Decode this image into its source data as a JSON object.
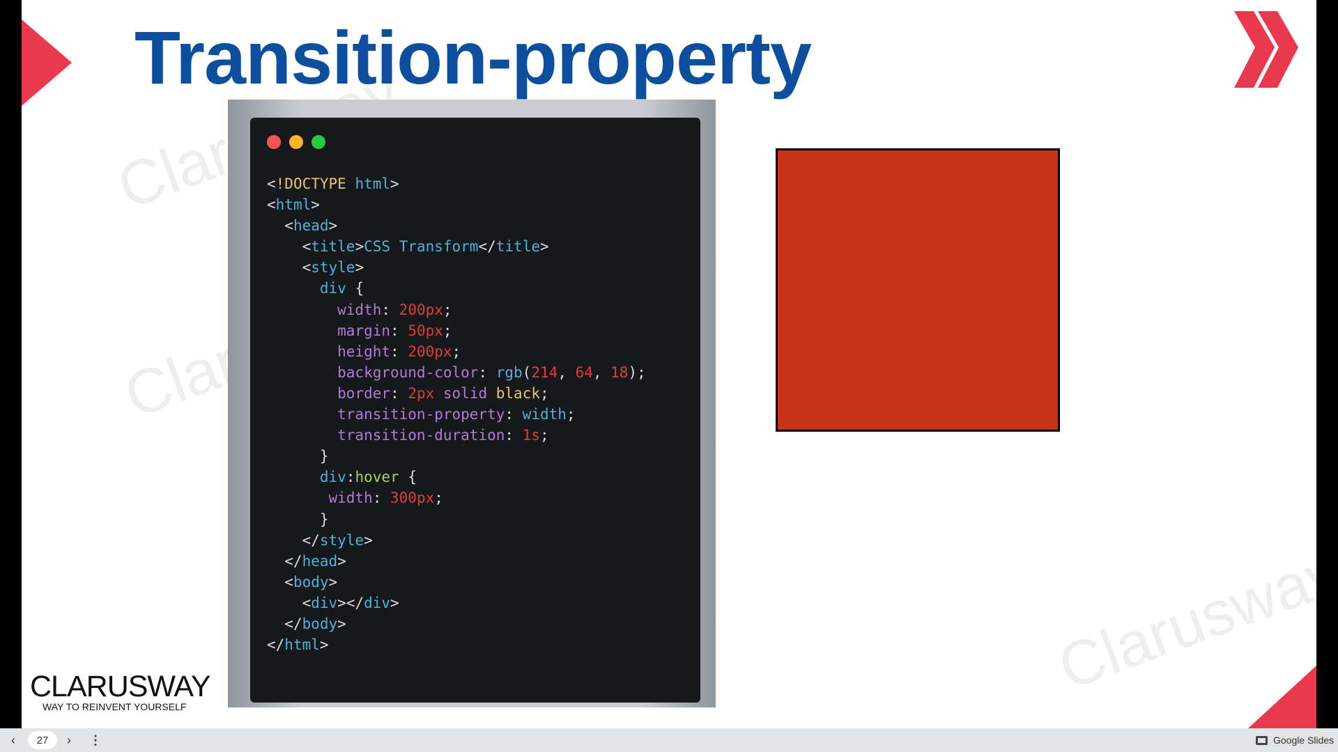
{
  "slide": {
    "title": "Transition-property",
    "code": [
      [
        [
          "p",
          "<"
        ],
        [
          "k",
          "!DOCTYPE"
        ],
        [
          "p",
          " "
        ],
        [
          "t",
          "html"
        ],
        [
          "p",
          ">"
        ]
      ],
      [
        [
          "p",
          "<"
        ],
        [
          "t",
          "html"
        ],
        [
          "p",
          ">"
        ]
      ],
      [
        [
          "p",
          "  <"
        ],
        [
          "t",
          "head"
        ],
        [
          "p",
          ">"
        ]
      ],
      [
        [
          "p",
          "    <"
        ],
        [
          "t",
          "title"
        ],
        [
          "p",
          ">"
        ],
        [
          "t",
          "CSS Transform"
        ],
        [
          "p",
          "</"
        ],
        [
          "t",
          "title"
        ],
        [
          "p",
          ">"
        ]
      ],
      [
        [
          "p",
          "    <"
        ],
        [
          "t",
          "style"
        ],
        [
          "p",
          ">"
        ]
      ],
      [
        [
          "t",
          "      div"
        ],
        [
          "p",
          " {"
        ]
      ],
      [
        [
          "a",
          "        width"
        ],
        [
          "p",
          ": "
        ],
        [
          "n",
          "200px"
        ],
        [
          "p",
          ";"
        ]
      ],
      [
        [
          "a",
          "        margin"
        ],
        [
          "p",
          ": "
        ],
        [
          "n",
          "50px"
        ],
        [
          "p",
          ";"
        ]
      ],
      [
        [
          "a",
          "        height"
        ],
        [
          "p",
          ": "
        ],
        [
          "n",
          "200px"
        ],
        [
          "p",
          ";"
        ]
      ],
      [
        [
          "a",
          "        background-color"
        ],
        [
          "p",
          ": "
        ],
        [
          "t",
          "rgb"
        ],
        [
          "p",
          "("
        ],
        [
          "n",
          "214"
        ],
        [
          "p",
          ", "
        ],
        [
          "n",
          "64"
        ],
        [
          "p",
          ", "
        ],
        [
          "n",
          "18"
        ],
        [
          "p",
          ");"
        ]
      ],
      [
        [
          "a",
          "        border"
        ],
        [
          "p",
          ": "
        ],
        [
          "n",
          "2px"
        ],
        [
          "a",
          " solid "
        ],
        [
          "k",
          "black"
        ],
        [
          "p",
          ";"
        ]
      ],
      [
        [
          "a",
          "        transition-property"
        ],
        [
          "p",
          ": "
        ],
        [
          "t",
          "width"
        ],
        [
          "p",
          ";"
        ]
      ],
      [
        [
          "a",
          "        transition-duration"
        ],
        [
          "p",
          ": "
        ],
        [
          "n",
          "1s"
        ],
        [
          "p",
          ";"
        ]
      ],
      [
        [
          "p",
          "      }"
        ]
      ],
      [
        [
          "t",
          "      div"
        ],
        [
          "p",
          ":"
        ],
        [
          "g",
          "hover"
        ],
        [
          "p",
          " {"
        ]
      ],
      [
        [
          "a",
          "       width"
        ],
        [
          "p",
          ": "
        ],
        [
          "n",
          "300px"
        ],
        [
          "p",
          ";"
        ]
      ],
      [
        [
          "p",
          "      }"
        ]
      ],
      [
        [
          "p",
          "    </"
        ],
        [
          "t",
          "style"
        ],
        [
          "p",
          ">"
        ]
      ],
      [
        [
          "p",
          "  </"
        ],
        [
          "t",
          "head"
        ],
        [
          "p",
          ">"
        ]
      ],
      [
        [
          "p",
          "  <"
        ],
        [
          "t",
          "body"
        ],
        [
          "p",
          ">"
        ]
      ],
      [
        [
          "p",
          "    <"
        ],
        [
          "t",
          "div"
        ],
        [
          "p",
          "></"
        ],
        [
          "t",
          "div"
        ],
        [
          "p",
          ">"
        ]
      ],
      [
        [
          "p",
          "  </"
        ],
        [
          "t",
          "body"
        ],
        [
          "p",
          ">"
        ]
      ],
      [
        [
          "p",
          "</"
        ],
        [
          "t",
          "html"
        ],
        [
          "p",
          ">"
        ]
      ]
    ],
    "logo": {
      "name": "CLARUSWAY",
      "tagline": "WAY TO REINVENT YOURSELF"
    },
    "watermark": "Clarusway"
  },
  "toolbar": {
    "page_number": "27",
    "app_label": "Google Slides"
  },
  "colors": {
    "title": "#0d4f9c",
    "accent": "#e8394f",
    "box": "#c8311a"
  }
}
